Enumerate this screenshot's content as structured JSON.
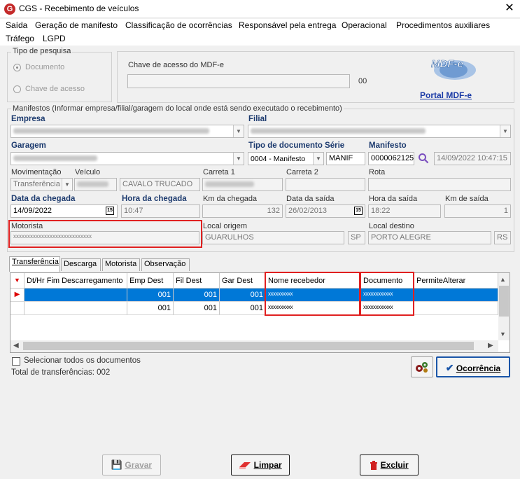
{
  "window": {
    "title": "CGS - Recebimento de veículos",
    "app_icon": "G"
  },
  "menu": [
    "Saída",
    "Geração de manifesto",
    "Classificação de ocorrências",
    "Responsável pela entrega",
    "Operacional",
    "Procedimentos auxiliares",
    "Tráfego",
    "LGPD"
  ],
  "tipo_pesquisa": {
    "legend": "Tipo de pesquisa",
    "opt1": "Documento",
    "opt2": "Chave de acesso"
  },
  "chave": {
    "label": "Chave de acesso do MDF-e",
    "count": "00",
    "portal_link": "Portal MDF-e",
    "logo_text": "MDF-e"
  },
  "manifestos": {
    "legend": "Manifestos (Informar empresa/filial/garagem do local onde está sendo executado o recebimento)",
    "empresa_label": "Empresa",
    "filial_label": "Filial",
    "garagem_label": "Garagem",
    "tipo_doc_label": "Tipo de documento Série",
    "tipo_doc_value": "0004 - Manifesto",
    "serie_value": "MANIF",
    "manifesto_label": "Manifesto",
    "manifesto_value": "0000062125",
    "manifesto_date": "14/09/2022 10:47:15",
    "movimentacao_label": "Movimentação",
    "movimentacao_value": "Transferência",
    "veiculo_label": "Veículo",
    "veiculo_desc": "CAVALO TRUCADO",
    "carreta1_label": "Carreta 1",
    "carreta2_label": "Carreta 2",
    "rota_label": "Rota",
    "data_chegada_label": "Data da chegada",
    "data_chegada_value": "14/09/2022",
    "hora_chegada_label": "Hora da chegada",
    "hora_chegada_value": "10:47",
    "km_chegada_label": "Km da chegada",
    "km_chegada_value": "132",
    "data_saida_label": "Data da saída",
    "data_saida_value": "26/02/2013",
    "hora_saida_label": "Hora da saída",
    "hora_saida_value": "18:22",
    "km_saida_label": "Km de saída",
    "km_saida_value": "1",
    "motorista_label": "Motorista",
    "motorista_value": "xxxxxxxxxxxxxxxxxxxxxxxxxxxx",
    "origem_label": "Local origem",
    "origem_value": "GUARULHOS",
    "origem_uf": "SP",
    "destino_label": "Local destino",
    "destino_value": "PORTO ALEGRE",
    "destino_uf": "RS",
    "cal_icon_text": "15"
  },
  "tabs": [
    "Transferência",
    "Descarga",
    "Motorista",
    "Observação"
  ],
  "grid": {
    "headers": [
      "Dt/Hr Fim Descarregamento",
      "Emp Dest",
      "Fil Dest",
      "Gar Dest",
      "Nome recebedor",
      "Documento",
      "PermiteAlterar"
    ],
    "rows": [
      {
        "dthr": "",
        "emp": "001",
        "fil": "001",
        "gar": "001",
        "nome": "xxxxxxxxxx",
        "doc": "xxxxxxxxxxxx"
      },
      {
        "dthr": "",
        "emp": "001",
        "fil": "001",
        "gar": "001",
        "nome": "xxxxxxxxxx",
        "doc": "xxxxxxxxxxxx"
      }
    ]
  },
  "footer": {
    "select_all": "Selecionar todos os documentos",
    "total": "Total de transferências: 002",
    "ocorrencia": "Ocorrência",
    "gravar": "Gravar",
    "limpar": "Limpar",
    "excluir": "Excluir"
  }
}
